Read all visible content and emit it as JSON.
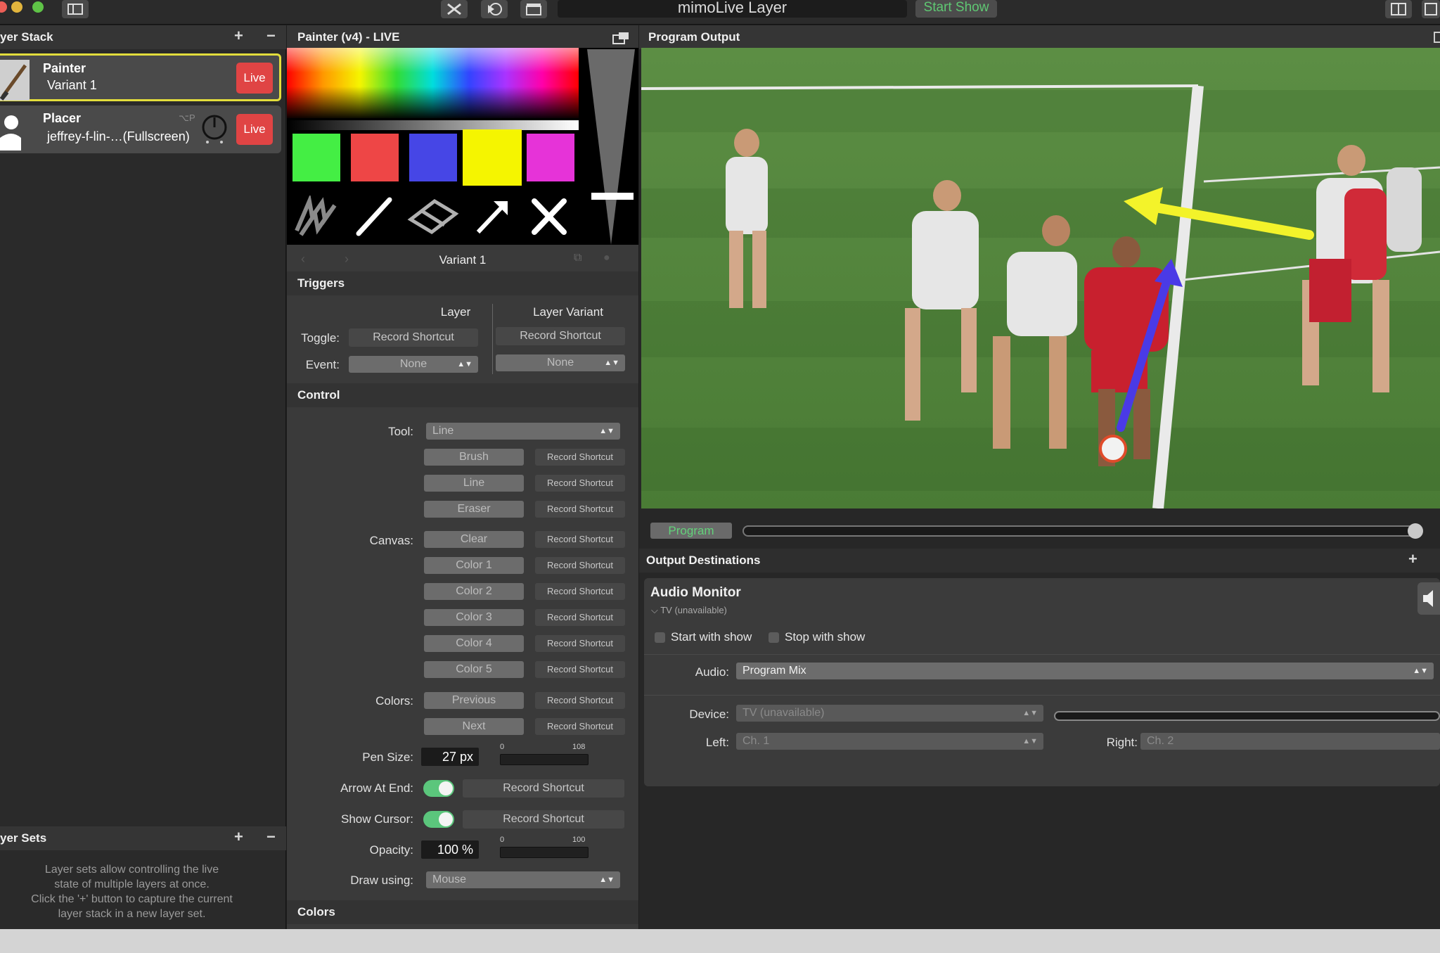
{
  "app": {
    "title": "mimoLive Layer",
    "start_show": "Start Show"
  },
  "colors": {
    "live_red": "#e04444",
    "selection_yellow": "#e2dd3c",
    "toggle_green": "#5bc67c",
    "program_green": "#62d27a"
  },
  "layer_stack": {
    "header": "yer Stack",
    "add": "+",
    "remove": "−",
    "layers": [
      {
        "name": "Painter",
        "variant": "Variant 1",
        "live": "Live",
        "icon": "brush-icon"
      },
      {
        "name": "Placer",
        "variant": "jeffrey-f-lin-…(Fullscreen)",
        "shortcut": "⌥P",
        "live": "Live",
        "icon": "person-silhouette-icon"
      }
    ]
  },
  "layer_sets": {
    "header": "yer Sets",
    "add": "+",
    "remove": "−",
    "help": [
      "Layer sets allow controlling the live",
      "state of multiple layers at once.",
      "Click the '+' button to capture the current",
      "layer stack in a new layer set."
    ]
  },
  "painter": {
    "header": "Painter (v4) - LIVE",
    "swatches": [
      "#44ee44",
      "#ee4646",
      "#4646e6",
      "#f5f500",
      "#e633d8"
    ],
    "tools": [
      "brush-tool-icon",
      "line-tool-icon",
      "eraser-tool-icon",
      "arrow-tool-icon",
      "clear-tool-icon"
    ],
    "variant": "Variant 1",
    "triggers": {
      "title": "Triggers",
      "col_layer": "Layer",
      "col_variant": "Layer Variant",
      "toggle_label": "Toggle:",
      "event_label": "Event:",
      "record": "Record Shortcut",
      "none": "None"
    },
    "control": {
      "title": "Control",
      "tool_label": "Tool:",
      "tool_value": "Line",
      "tool_buttons": [
        "Brush",
        "Line",
        "Eraser"
      ],
      "canvas_label": "Canvas:",
      "canvas_buttons": [
        "Clear",
        "Color 1",
        "Color 2",
        "Color 3",
        "Color 4",
        "Color 5"
      ],
      "colors_label": "Colors:",
      "colors_buttons": [
        "Previous",
        "Next"
      ],
      "record": "Record Shortcut",
      "pen_size_label": "Pen Size:",
      "pen_size_value": "27 px",
      "pen_min": "0",
      "pen_max": "108",
      "arrow_label": "Arrow At End:",
      "cursor_label": "Show Cursor:",
      "opacity_label": "Opacity:",
      "opacity_value": "100 %",
      "opacity_min": "0",
      "opacity_max": "100",
      "draw_label": "Draw using:",
      "draw_value": "Mouse"
    },
    "colors_title": "Colors"
  },
  "program": {
    "header": "Program Output",
    "tag": "Program"
  },
  "output": {
    "header": "Output Destinations",
    "add": "+",
    "name": "Audio Monitor",
    "device_sub": "TV (unavailable)",
    "start_with_show": "Start with show",
    "stop_with_show": "Stop with show",
    "audio_label": "Audio:",
    "audio_value": "Program Mix",
    "device_label": "Device:",
    "device_value": "TV (unavailable)",
    "left_label": "Left:",
    "left_value": "Ch. 1",
    "right_label": "Right:",
    "right_value": "Ch. 2"
  }
}
